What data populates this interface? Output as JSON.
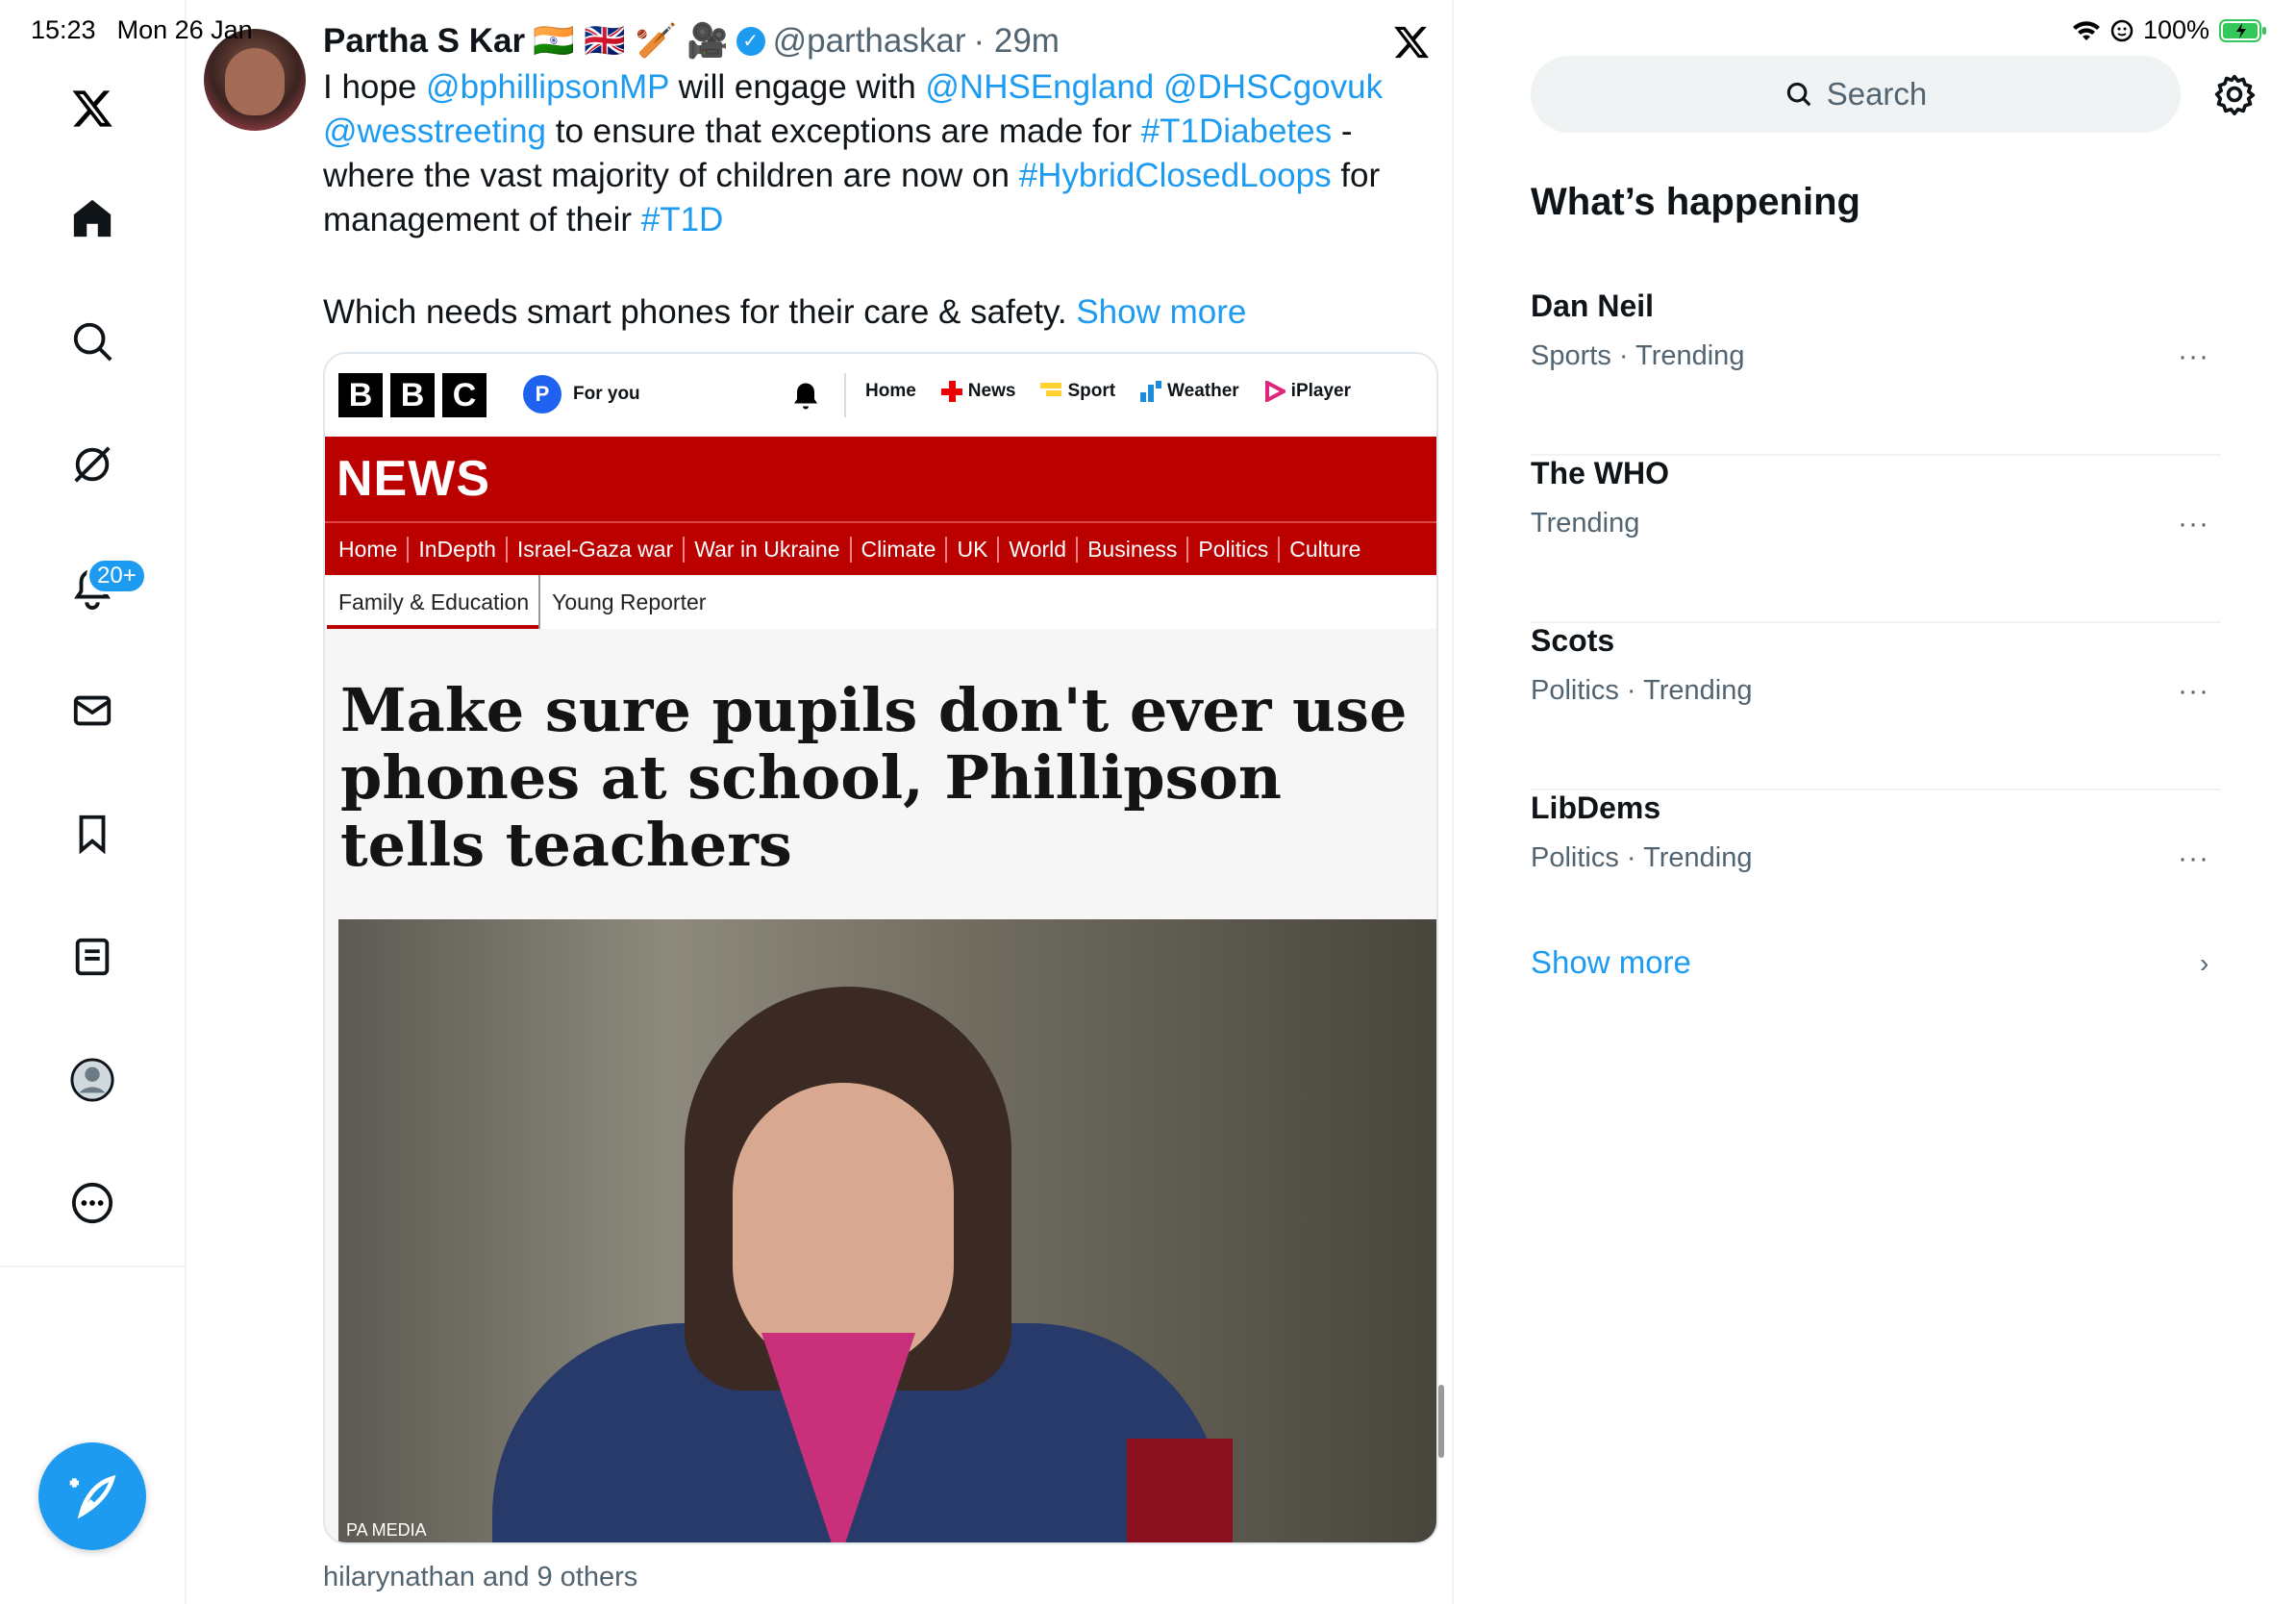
{
  "status": {
    "time": "15:23",
    "date": "Mon 26 Jan",
    "battery": "100%"
  },
  "nav": {
    "items": [
      "x-logo",
      "home",
      "search",
      "grok",
      "notifications",
      "messages",
      "bookmarks",
      "lists",
      "profile",
      "more"
    ],
    "notifications_badge": "20+",
    "post_button": "compose"
  },
  "tweet": {
    "author_name": "Partha S Kar",
    "author_emojis": "🇮🇳 🇬🇧 🏏 🎥",
    "handle": "@parthaskar",
    "time": "· 29m",
    "body_parts": [
      {
        "text": "I hope ",
        "link": false
      },
      {
        "text": "@bphillipsonMP",
        "link": true
      },
      {
        "text": " will engage with ",
        "link": false
      },
      {
        "text": "@NHSEngland",
        "link": true
      },
      {
        "text": " ",
        "link": false
      },
      {
        "text": "@DHSCgovuk",
        "link": true
      },
      {
        "text": " ",
        "link": false
      },
      {
        "text": "@wesstreeting",
        "link": true
      },
      {
        "text": " to ensure that exceptions are made for ",
        "link": false
      },
      {
        "text": "#T1Diabetes",
        "link": true
      },
      {
        "text": " - where the vast majority of children are now on ",
        "link": false
      },
      {
        "text": "#HybridClosedLoops",
        "link": true
      },
      {
        "text": " for management of their ",
        "link": false
      },
      {
        "text": "#T1D",
        "link": true
      }
    ],
    "second_paragraph": "Which needs smart phones for their care & safety.",
    "show_more": "Show more",
    "liked_by": "hilarynathan and 9 others"
  },
  "bbc": {
    "logo_letters": [
      "B",
      "B",
      "C"
    ],
    "foryou_initial": "P",
    "foryou": "For you",
    "top_links": [
      "Home",
      "News",
      "Sport",
      "Weather",
      "iPlayer"
    ],
    "news_label": "NEWS",
    "nav": [
      "Home",
      "InDepth",
      "Israel-Gaza war",
      "War in Ukraine",
      "Climate",
      "UK",
      "World",
      "Business",
      "Politics",
      "Culture"
    ],
    "sub_active": "Family & Education",
    "sub_other": "Young Reporter",
    "headline": "Make sure pupils don't ever use phones at school, Phillipson tells teachers",
    "photo_credit": "PA MEDIA"
  },
  "sidebar": {
    "search_placeholder": "Search",
    "section_title": "What’s happening",
    "trends": [
      {
        "title": "Dan Neil",
        "meta": "Sports · Trending"
      },
      {
        "title": "The WHO",
        "meta": "Trending"
      },
      {
        "title": "Scots",
        "meta": "Politics · Trending"
      },
      {
        "title": "LibDems",
        "meta": "Politics · Trending"
      }
    ],
    "more_icon": "···",
    "show_more": "Show more",
    "chevron": "›"
  },
  "colors": {
    "accent": "#1d9bf0",
    "bbc_red": "#bb0000",
    "secondary_text": "#536471"
  }
}
